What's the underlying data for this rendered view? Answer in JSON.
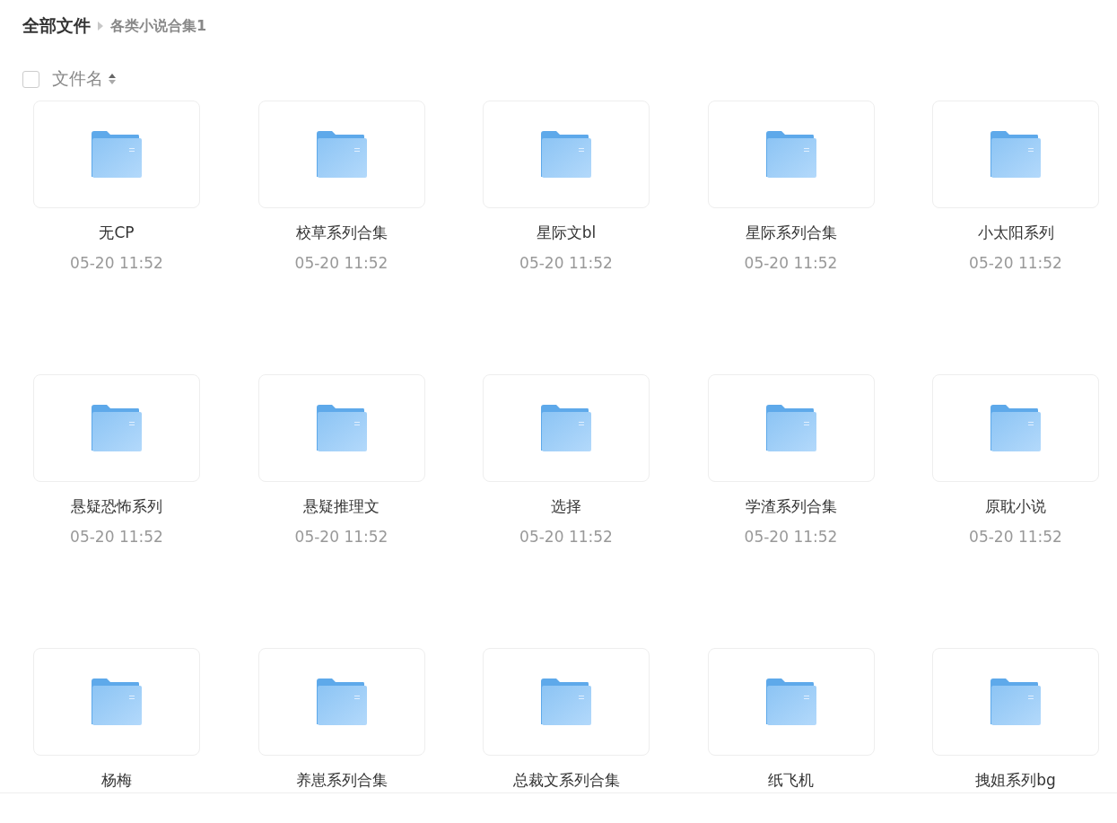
{
  "breadcrumb": [
    {
      "label": "全部文件"
    },
    {
      "label": "各类小说合集1"
    }
  ],
  "list_header": {
    "checked": false,
    "sort_label": "文件名"
  },
  "folders": [
    {
      "name": "无CP",
      "date": "05-20 11:52"
    },
    {
      "name": "校草系列合集",
      "date": "05-20 11:52"
    },
    {
      "name": "星际文bl",
      "date": "05-20 11:52"
    },
    {
      "name": "星际系列合集",
      "date": "05-20 11:52"
    },
    {
      "name": "小太阳系列",
      "date": "05-20 11:52"
    },
    {
      "name": "悬疑恐怖系列",
      "date": "05-20 11:52"
    },
    {
      "name": "悬疑推理文",
      "date": "05-20 11:52"
    },
    {
      "name": "选择",
      "date": "05-20 11:52"
    },
    {
      "name": "学渣系列合集",
      "date": "05-20 11:52"
    },
    {
      "name": "原耽小说",
      "date": "05-20 11:52"
    },
    {
      "name": "杨梅"
    },
    {
      "name": "养崽系列合集"
    },
    {
      "name": "总裁文系列合集"
    },
    {
      "name": "纸飞机"
    },
    {
      "name": "拽姐系列bg"
    }
  ]
}
